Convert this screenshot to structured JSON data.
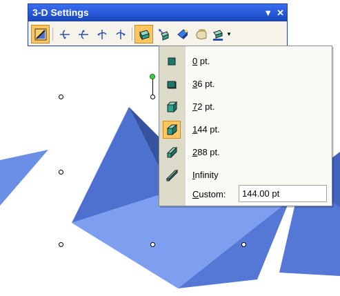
{
  "toolbar": {
    "title": "3-D Settings",
    "buttons": [
      {
        "name": "3d-on-off-icon",
        "state": "pressed"
      },
      {
        "name": "tilt-down-icon"
      },
      {
        "name": "tilt-up-icon"
      },
      {
        "name": "tilt-left-icon"
      },
      {
        "name": "tilt-right-icon"
      },
      {
        "name": "depth-icon",
        "state": "active"
      },
      {
        "name": "direction-icon"
      },
      {
        "name": "lighting-icon"
      },
      {
        "name": "surface-icon"
      },
      {
        "name": "3d-color-icon"
      }
    ],
    "menu_arrow": "▼",
    "close": "✕"
  },
  "depth_menu": {
    "items": [
      {
        "accel": "0",
        "rest": " pt.",
        "selected": false
      },
      {
        "accel": "3",
        "rest": "6 pt.",
        "selected": false
      },
      {
        "accel": "7",
        "rest": "2 pt.",
        "selected": false
      },
      {
        "accel": "1",
        "rest": "44 pt.",
        "selected": true
      },
      {
        "accel": "2",
        "rest": "88 pt.",
        "selected": false
      },
      {
        "accel": "I",
        "rest": "nfinity",
        "selected": false
      }
    ],
    "custom_label_accel": "C",
    "custom_label_rest": "ustom:",
    "custom_value": "144.00 pt"
  },
  "colors": {
    "shape_light": "#6b8ee6",
    "shape_mid": "#4e70cf",
    "shape_dark": "#35539f",
    "accent_active": "#ffc660"
  }
}
